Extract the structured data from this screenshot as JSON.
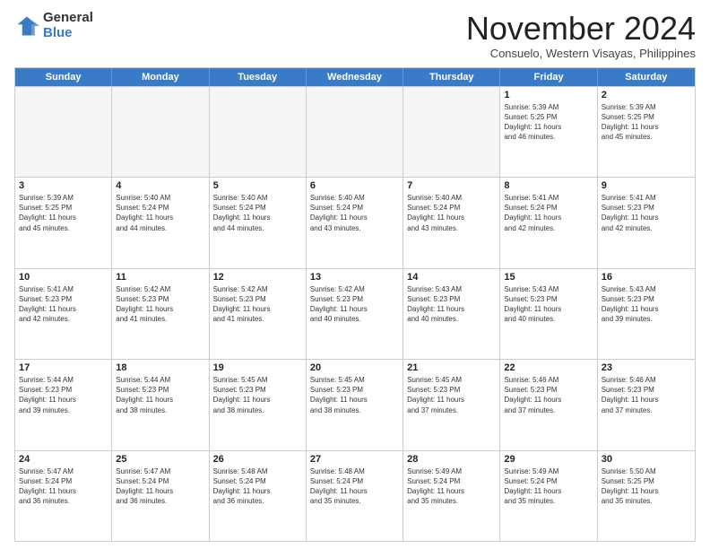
{
  "logo": {
    "general": "General",
    "blue": "Blue"
  },
  "title": "November 2024",
  "subtitle": "Consuelo, Western Visayas, Philippines",
  "header_days": [
    "Sunday",
    "Monday",
    "Tuesday",
    "Wednesday",
    "Thursday",
    "Friday",
    "Saturday"
  ],
  "weeks": [
    [
      {
        "day": "",
        "info": "",
        "empty": true
      },
      {
        "day": "",
        "info": "",
        "empty": true
      },
      {
        "day": "",
        "info": "",
        "empty": true
      },
      {
        "day": "",
        "info": "",
        "empty": true
      },
      {
        "day": "",
        "info": "",
        "empty": true
      },
      {
        "day": "1",
        "info": "Sunrise: 5:39 AM\nSunset: 5:25 PM\nDaylight: 11 hours\nand 46 minutes.",
        "empty": false
      },
      {
        "day": "2",
        "info": "Sunrise: 5:39 AM\nSunset: 5:25 PM\nDaylight: 11 hours\nand 45 minutes.",
        "empty": false
      }
    ],
    [
      {
        "day": "3",
        "info": "Sunrise: 5:39 AM\nSunset: 5:25 PM\nDaylight: 11 hours\nand 45 minutes.",
        "empty": false
      },
      {
        "day": "4",
        "info": "Sunrise: 5:40 AM\nSunset: 5:24 PM\nDaylight: 11 hours\nand 44 minutes.",
        "empty": false
      },
      {
        "day": "5",
        "info": "Sunrise: 5:40 AM\nSunset: 5:24 PM\nDaylight: 11 hours\nand 44 minutes.",
        "empty": false
      },
      {
        "day": "6",
        "info": "Sunrise: 5:40 AM\nSunset: 5:24 PM\nDaylight: 11 hours\nand 43 minutes.",
        "empty": false
      },
      {
        "day": "7",
        "info": "Sunrise: 5:40 AM\nSunset: 5:24 PM\nDaylight: 11 hours\nand 43 minutes.",
        "empty": false
      },
      {
        "day": "8",
        "info": "Sunrise: 5:41 AM\nSunset: 5:24 PM\nDaylight: 11 hours\nand 42 minutes.",
        "empty": false
      },
      {
        "day": "9",
        "info": "Sunrise: 5:41 AM\nSunset: 5:23 PM\nDaylight: 11 hours\nand 42 minutes.",
        "empty": false
      }
    ],
    [
      {
        "day": "10",
        "info": "Sunrise: 5:41 AM\nSunset: 5:23 PM\nDaylight: 11 hours\nand 42 minutes.",
        "empty": false
      },
      {
        "day": "11",
        "info": "Sunrise: 5:42 AM\nSunset: 5:23 PM\nDaylight: 11 hours\nand 41 minutes.",
        "empty": false
      },
      {
        "day": "12",
        "info": "Sunrise: 5:42 AM\nSunset: 5:23 PM\nDaylight: 11 hours\nand 41 minutes.",
        "empty": false
      },
      {
        "day": "13",
        "info": "Sunrise: 5:42 AM\nSunset: 5:23 PM\nDaylight: 11 hours\nand 40 minutes.",
        "empty": false
      },
      {
        "day": "14",
        "info": "Sunrise: 5:43 AM\nSunset: 5:23 PM\nDaylight: 11 hours\nand 40 minutes.",
        "empty": false
      },
      {
        "day": "15",
        "info": "Sunrise: 5:43 AM\nSunset: 5:23 PM\nDaylight: 11 hours\nand 40 minutes.",
        "empty": false
      },
      {
        "day": "16",
        "info": "Sunrise: 5:43 AM\nSunset: 5:23 PM\nDaylight: 11 hours\nand 39 minutes.",
        "empty": false
      }
    ],
    [
      {
        "day": "17",
        "info": "Sunrise: 5:44 AM\nSunset: 5:23 PM\nDaylight: 11 hours\nand 39 minutes.",
        "empty": false
      },
      {
        "day": "18",
        "info": "Sunrise: 5:44 AM\nSunset: 5:23 PM\nDaylight: 11 hours\nand 38 minutes.",
        "empty": false
      },
      {
        "day": "19",
        "info": "Sunrise: 5:45 AM\nSunset: 5:23 PM\nDaylight: 11 hours\nand 38 minutes.",
        "empty": false
      },
      {
        "day": "20",
        "info": "Sunrise: 5:45 AM\nSunset: 5:23 PM\nDaylight: 11 hours\nand 38 minutes.",
        "empty": false
      },
      {
        "day": "21",
        "info": "Sunrise: 5:45 AM\nSunset: 5:23 PM\nDaylight: 11 hours\nand 37 minutes.",
        "empty": false
      },
      {
        "day": "22",
        "info": "Sunrise: 5:46 AM\nSunset: 5:23 PM\nDaylight: 11 hours\nand 37 minutes.",
        "empty": false
      },
      {
        "day": "23",
        "info": "Sunrise: 5:46 AM\nSunset: 5:23 PM\nDaylight: 11 hours\nand 37 minutes.",
        "empty": false
      }
    ],
    [
      {
        "day": "24",
        "info": "Sunrise: 5:47 AM\nSunset: 5:24 PM\nDaylight: 11 hours\nand 36 minutes.",
        "empty": false
      },
      {
        "day": "25",
        "info": "Sunrise: 5:47 AM\nSunset: 5:24 PM\nDaylight: 11 hours\nand 36 minutes.",
        "empty": false
      },
      {
        "day": "26",
        "info": "Sunrise: 5:48 AM\nSunset: 5:24 PM\nDaylight: 11 hours\nand 36 minutes.",
        "empty": false
      },
      {
        "day": "27",
        "info": "Sunrise: 5:48 AM\nSunset: 5:24 PM\nDaylight: 11 hours\nand 35 minutes.",
        "empty": false
      },
      {
        "day": "28",
        "info": "Sunrise: 5:49 AM\nSunset: 5:24 PM\nDaylight: 11 hours\nand 35 minutes.",
        "empty": false
      },
      {
        "day": "29",
        "info": "Sunrise: 5:49 AM\nSunset: 5:24 PM\nDaylight: 11 hours\nand 35 minutes.",
        "empty": false
      },
      {
        "day": "30",
        "info": "Sunrise: 5:50 AM\nSunset: 5:25 PM\nDaylight: 11 hours\nand 35 minutes.",
        "empty": false
      }
    ]
  ]
}
